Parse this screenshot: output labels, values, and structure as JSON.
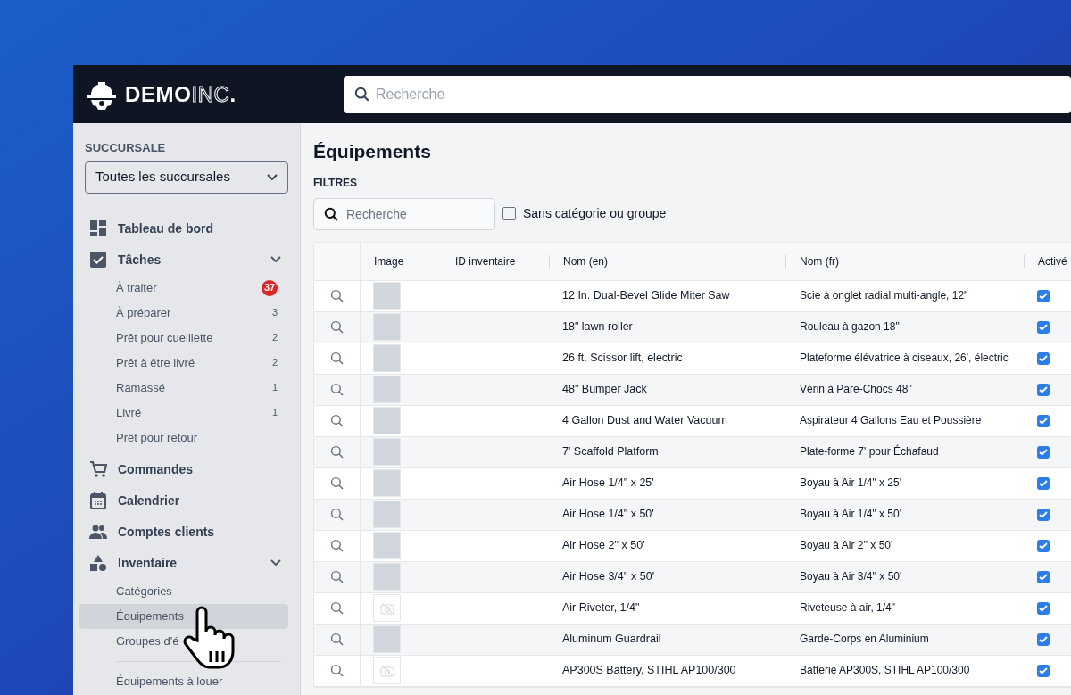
{
  "header": {
    "logo": {
      "bold": "DEMO",
      "outline": "INC",
      "dot": "."
    },
    "search": {
      "placeholder": "Recherche"
    }
  },
  "sidebar": {
    "branch_label": "SUCCURSALE",
    "branch_select": {
      "value": "Toutes les succursales"
    },
    "items": [
      {
        "label": "Tableau de bord",
        "kind": "dashboard",
        "selected": false
      },
      {
        "label": "Tâches",
        "kind": "tasks",
        "selected": false,
        "expanded": true,
        "children": [
          {
            "label": "À traiter",
            "count": "37",
            "alert": true,
            "selected": false
          },
          {
            "label": "À préparer",
            "count": "3",
            "alert": false,
            "selected": false
          },
          {
            "label": "Prêt pour cueillette",
            "count": "2",
            "alert": false,
            "selected": false
          },
          {
            "label": "Prêt à être livré",
            "count": "2",
            "alert": false,
            "selected": false
          },
          {
            "label": "Ramassé",
            "count": "1",
            "alert": false,
            "selected": false
          },
          {
            "label": "Livré",
            "count": "1",
            "alert": false,
            "selected": false
          },
          {
            "label": "Prêt pour retour",
            "selected": false
          }
        ]
      },
      {
        "label": "Commandes",
        "kind": "cart",
        "selected": false
      },
      {
        "label": "Calendrier",
        "kind": "calendar",
        "selected": false
      },
      {
        "label": "Comptes clients",
        "kind": "people",
        "selected": false
      },
      {
        "label": "Inventaire",
        "kind": "shapes",
        "selected": false,
        "expanded": true,
        "children": [
          {
            "label": "Catégories",
            "selected": false,
            "divider_before": false
          },
          {
            "label": "Équipements",
            "selected": true,
            "divider_before": false
          },
          {
            "label": "Groupes d'é",
            "selected": false,
            "divider_before": false
          },
          {
            "label": "Équipements à louer",
            "selected": false,
            "divider_before": true
          }
        ]
      }
    ]
  },
  "main": {
    "title": "Équipements",
    "filters_label": "FILTRES",
    "filter_search": {
      "placeholder": "Recherche"
    },
    "filter_checkbox": {
      "label": "Sans catégorie ou groupe",
      "checked": false
    },
    "table": {
      "columns": [
        "Image",
        "ID inventaire",
        "Nom (en)",
        "Nom (fr)",
        "Activé"
      ],
      "rows": [
        {
          "kind": "photo",
          "name_en": "12 In. Dual-Bevel Glide Miter Saw",
          "name_fr": "Scie à onglet radial multi-angle, 12\"",
          "active": true
        },
        {
          "kind": "photo",
          "name_en": "18\" lawn roller",
          "name_fr": "Rouleau à gazon 18\"",
          "active": true
        },
        {
          "kind": "photo",
          "name_en": "26 ft. Scissor lift, electric",
          "name_fr": "Plateforme élévatrice à ciseaux, 26', électric",
          "active": true
        },
        {
          "kind": "photo",
          "name_en": "48\" Bumper Jack",
          "name_fr": "Vérin à Pare-Chocs 48\"",
          "active": true
        },
        {
          "kind": "photo",
          "name_en": "4 Gallon Dust and Water Vacuum",
          "name_fr": "Aspirateur 4 Gallons Eau et Poussière",
          "active": true
        },
        {
          "kind": "photo",
          "name_en": "7' Scaffold Platform",
          "name_fr": "Plate-forme 7' pour Échafaud",
          "active": true
        },
        {
          "kind": "photo",
          "name_en": "Air Hose 1/4\" x 25'",
          "name_fr": "Boyau à Air 1/4\" x 25'",
          "active": true
        },
        {
          "kind": "photo",
          "name_en": "Air Hose 1/4\" x 50'",
          "name_fr": "Boyau à Air 1/4\" x 50'",
          "active": true
        },
        {
          "kind": "photo",
          "name_en": "Air Hose 2'' x 50'",
          "name_fr": "Boyau à Air 2'' x 50'",
          "active": true
        },
        {
          "kind": "photo",
          "name_en": "Air Hose 3/4'' x 50'",
          "name_fr": "Boyau à Air 3/4'' x 50'",
          "active": true
        },
        {
          "kind": "none",
          "name_en": "Air Riveter, 1/4\"",
          "name_fr": "Riveteuse à air, 1/4\"",
          "active": true
        },
        {
          "kind": "photo",
          "name_en": "Aluminum Guardrail",
          "name_fr": "Garde-Corps en Aluminium",
          "active": true
        },
        {
          "kind": "none",
          "name_en": "AP300S Battery, STIHL AP100/300",
          "name_fr": "Batterie AP300S, STIHL AP100/300",
          "active": true
        }
      ]
    }
  }
}
